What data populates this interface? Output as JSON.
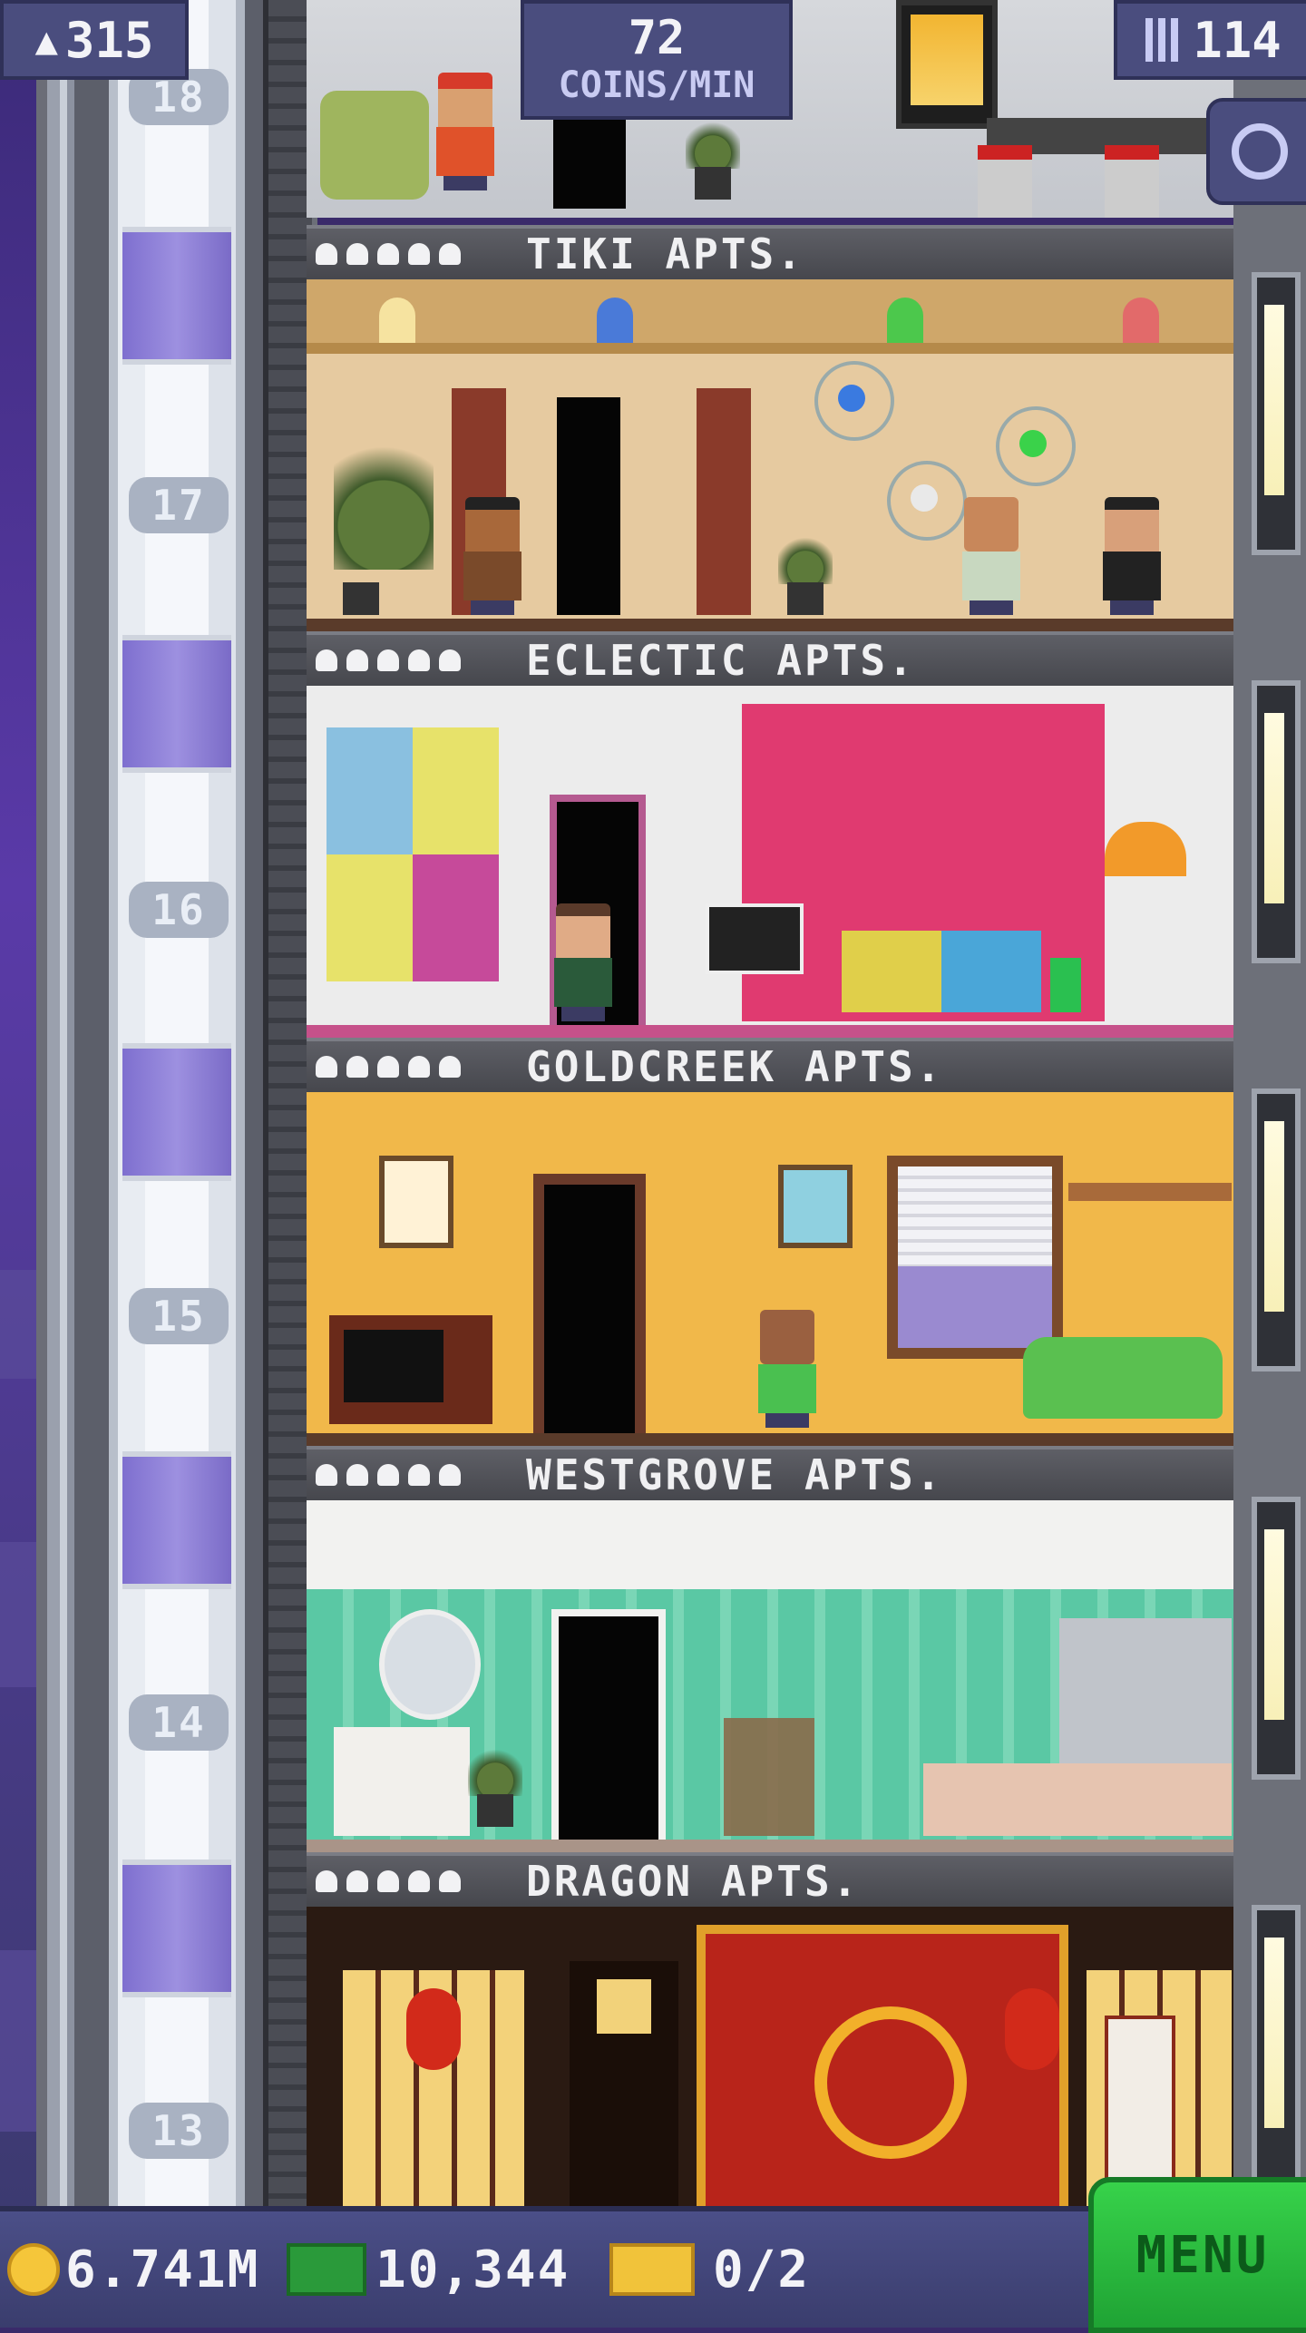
{
  "hud": {
    "population": "315",
    "coins_rate_value": "72",
    "coins_rate_label": "COINS/MIN",
    "floors_count": "114",
    "icons": {
      "population": "person-icon",
      "floors": "building-icon",
      "search": "magnifier-icon",
      "coins": "coin-icon",
      "bux": "tower-bux-icon",
      "tickets": "ticket-icon"
    }
  },
  "elevator": {
    "floor_numbers": [
      "18",
      "17",
      "16",
      "15",
      "14",
      "13"
    ]
  },
  "floors": [
    {
      "number": "17",
      "name": "TIKI APTS.",
      "stars": 5
    },
    {
      "number": "16",
      "name": "ECLECTIC APTS.",
      "stars": 5
    },
    {
      "number": "15",
      "name": "GOLDCREEK APTS.",
      "stars": 5
    },
    {
      "number": "14",
      "name": "WESTGROVE APTS.",
      "stars": 5
    },
    {
      "number": "13",
      "name": "DRAGON APTS.",
      "stars": 5
    }
  ],
  "bottom_bar": {
    "coins": "6.741M",
    "bux": "10,344",
    "tickets": "0/2",
    "menu_label": "MENU"
  },
  "colors": {
    "hud_bg": "#4a4d7e",
    "menu_green": "#2fc441",
    "coin_gold": "#f5c63a",
    "bux_green": "#2a9a3a",
    "ticket_yellow": "#f1c33a"
  }
}
